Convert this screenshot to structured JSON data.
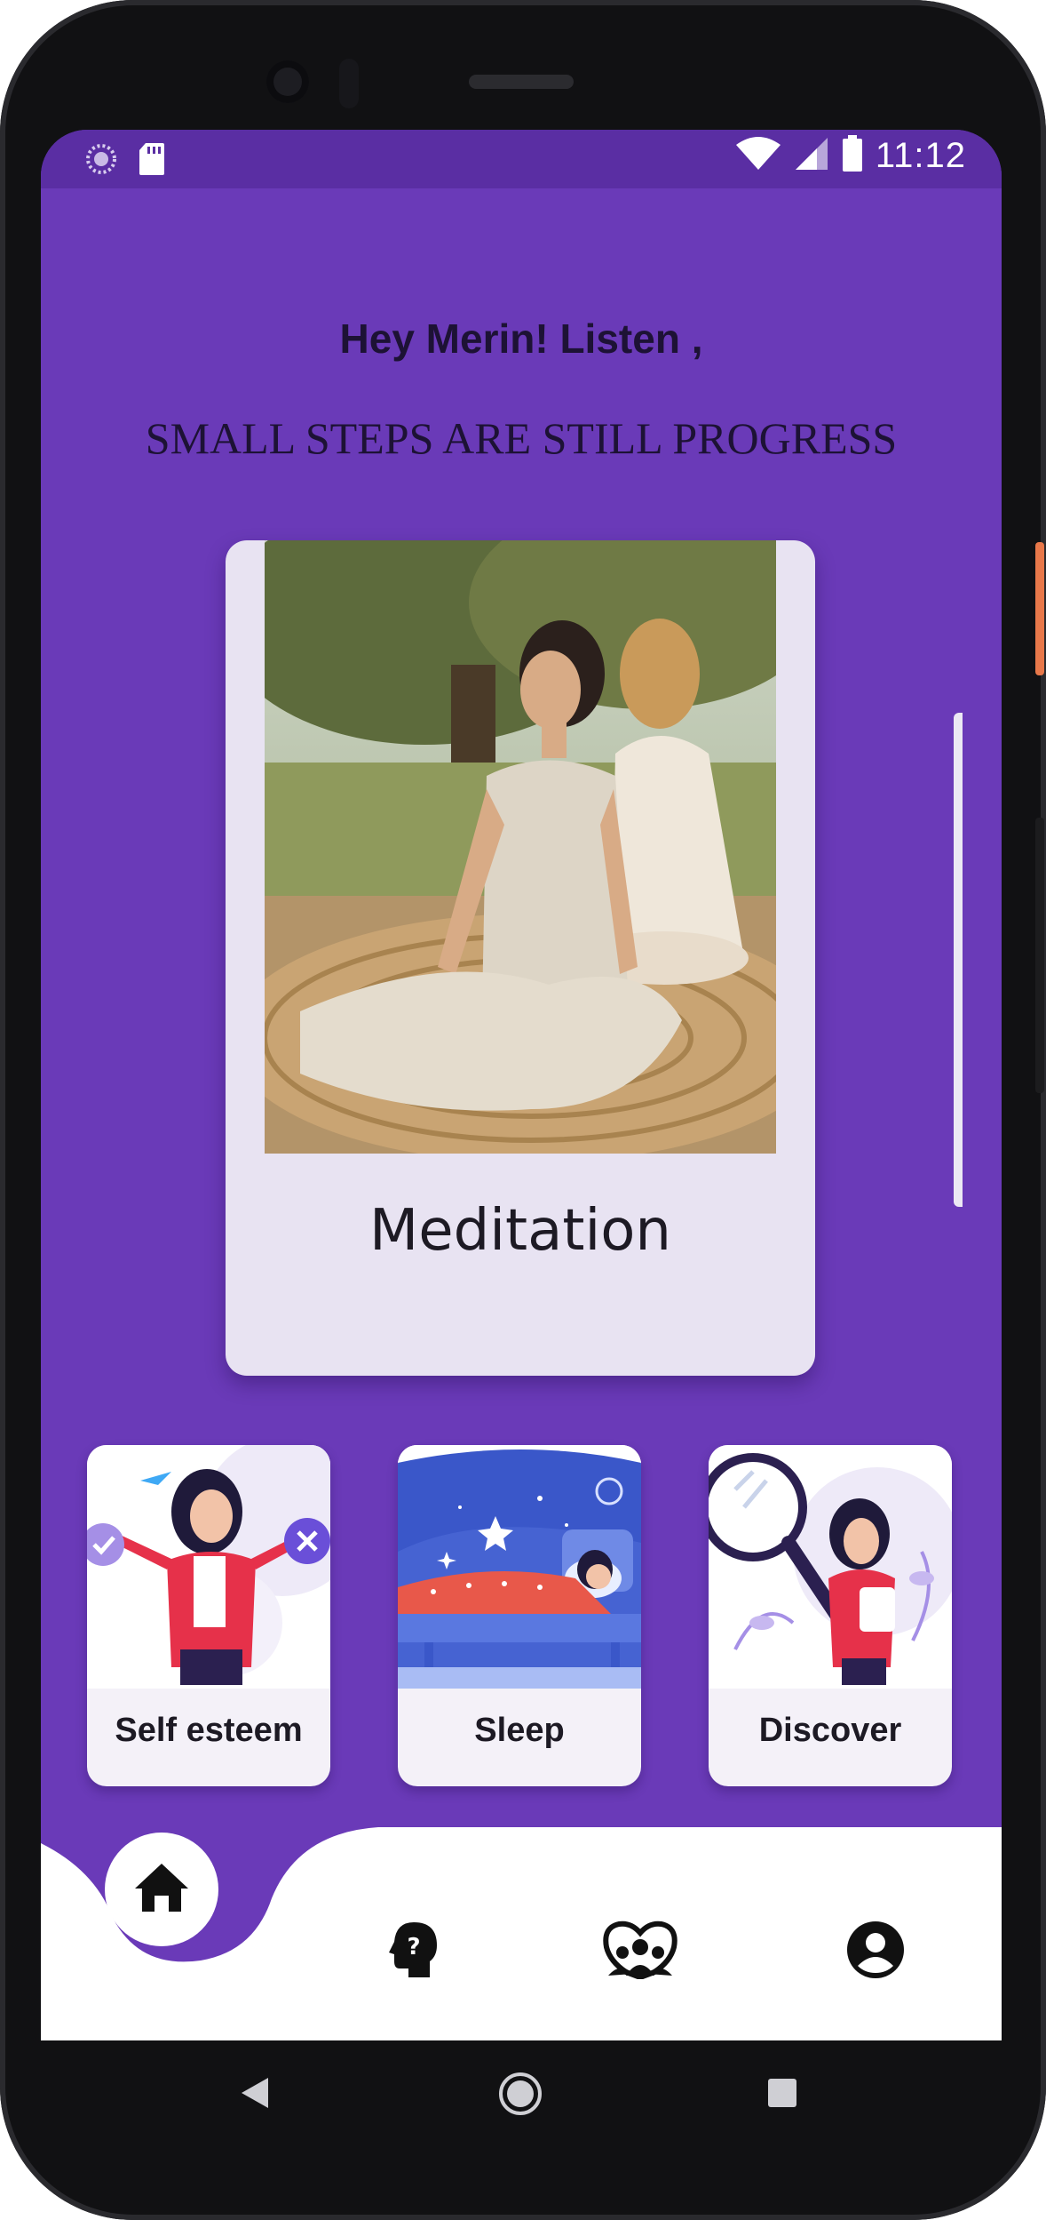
{
  "status_bar": {
    "time": "11:12",
    "icons": [
      "loading-circle-icon",
      "sd-card-icon",
      "wifi-icon",
      "cellular-signal-icon",
      "battery-icon"
    ]
  },
  "header": {
    "greeting": "Hey Merin! Listen ,",
    "quote": "SMALL STEPS ARE STILL PROGRESS"
  },
  "featured": {
    "label": "Meditation",
    "image": "meditation-photo"
  },
  "categories": [
    {
      "label": "Self esteem",
      "image": "self-esteem-illustration"
    },
    {
      "label": "Sleep",
      "image": "sleep-illustration"
    },
    {
      "label": "Discover",
      "image": "discover-illustration"
    }
  ],
  "bottom_nav": {
    "items": [
      "home-icon",
      "mental-health-question-icon",
      "community-group-icon",
      "profile-icon"
    ],
    "active": "home-icon"
  },
  "system_nav": [
    "back-icon",
    "home-circle-icon",
    "recents-icon"
  ],
  "colors": {
    "primary": "#6a3ab8",
    "status_bar": "#5a2ea3",
    "card": "#e8e3f2",
    "text_dark": "#1d1235"
  }
}
